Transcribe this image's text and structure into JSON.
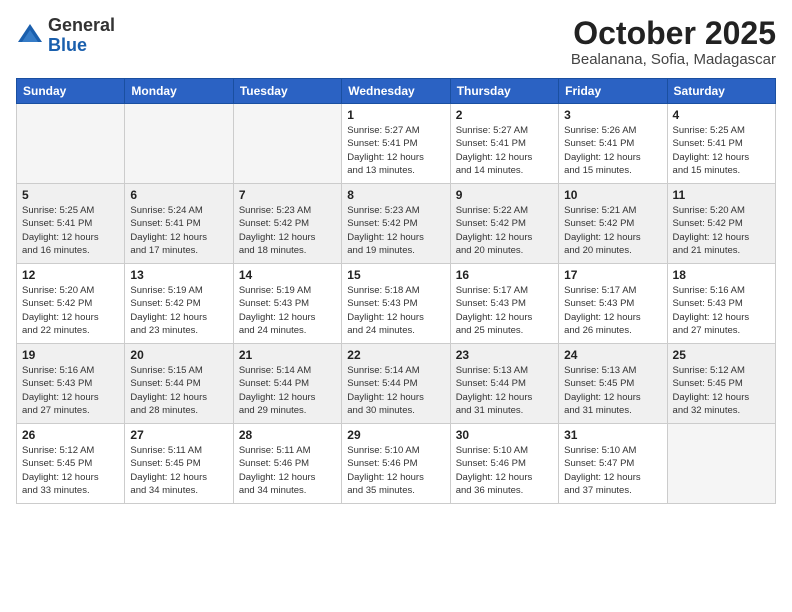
{
  "header": {
    "logo": {
      "general": "General",
      "blue": "Blue"
    },
    "title": "October 2025",
    "location": "Bealanana, Sofia, Madagascar"
  },
  "calendar": {
    "weekdays": [
      "Sunday",
      "Monday",
      "Tuesday",
      "Wednesday",
      "Thursday",
      "Friday",
      "Saturday"
    ],
    "weeks": [
      [
        {
          "day": "",
          "info": ""
        },
        {
          "day": "",
          "info": ""
        },
        {
          "day": "",
          "info": ""
        },
        {
          "day": "1",
          "info": "Sunrise: 5:27 AM\nSunset: 5:41 PM\nDaylight: 12 hours\nand 13 minutes."
        },
        {
          "day": "2",
          "info": "Sunrise: 5:27 AM\nSunset: 5:41 PM\nDaylight: 12 hours\nand 14 minutes."
        },
        {
          "day": "3",
          "info": "Sunrise: 5:26 AM\nSunset: 5:41 PM\nDaylight: 12 hours\nand 15 minutes."
        },
        {
          "day": "4",
          "info": "Sunrise: 5:25 AM\nSunset: 5:41 PM\nDaylight: 12 hours\nand 15 minutes."
        }
      ],
      [
        {
          "day": "5",
          "info": "Sunrise: 5:25 AM\nSunset: 5:41 PM\nDaylight: 12 hours\nand 16 minutes."
        },
        {
          "day": "6",
          "info": "Sunrise: 5:24 AM\nSunset: 5:41 PM\nDaylight: 12 hours\nand 17 minutes."
        },
        {
          "day": "7",
          "info": "Sunrise: 5:23 AM\nSunset: 5:42 PM\nDaylight: 12 hours\nand 18 minutes."
        },
        {
          "day": "8",
          "info": "Sunrise: 5:23 AM\nSunset: 5:42 PM\nDaylight: 12 hours\nand 19 minutes."
        },
        {
          "day": "9",
          "info": "Sunrise: 5:22 AM\nSunset: 5:42 PM\nDaylight: 12 hours\nand 20 minutes."
        },
        {
          "day": "10",
          "info": "Sunrise: 5:21 AM\nSunset: 5:42 PM\nDaylight: 12 hours\nand 20 minutes."
        },
        {
          "day": "11",
          "info": "Sunrise: 5:20 AM\nSunset: 5:42 PM\nDaylight: 12 hours\nand 21 minutes."
        }
      ],
      [
        {
          "day": "12",
          "info": "Sunrise: 5:20 AM\nSunset: 5:42 PM\nDaylight: 12 hours\nand 22 minutes."
        },
        {
          "day": "13",
          "info": "Sunrise: 5:19 AM\nSunset: 5:42 PM\nDaylight: 12 hours\nand 23 minutes."
        },
        {
          "day": "14",
          "info": "Sunrise: 5:19 AM\nSunset: 5:43 PM\nDaylight: 12 hours\nand 24 minutes."
        },
        {
          "day": "15",
          "info": "Sunrise: 5:18 AM\nSunset: 5:43 PM\nDaylight: 12 hours\nand 24 minutes."
        },
        {
          "day": "16",
          "info": "Sunrise: 5:17 AM\nSunset: 5:43 PM\nDaylight: 12 hours\nand 25 minutes."
        },
        {
          "day": "17",
          "info": "Sunrise: 5:17 AM\nSunset: 5:43 PM\nDaylight: 12 hours\nand 26 minutes."
        },
        {
          "day": "18",
          "info": "Sunrise: 5:16 AM\nSunset: 5:43 PM\nDaylight: 12 hours\nand 27 minutes."
        }
      ],
      [
        {
          "day": "19",
          "info": "Sunrise: 5:16 AM\nSunset: 5:43 PM\nDaylight: 12 hours\nand 27 minutes."
        },
        {
          "day": "20",
          "info": "Sunrise: 5:15 AM\nSunset: 5:44 PM\nDaylight: 12 hours\nand 28 minutes."
        },
        {
          "day": "21",
          "info": "Sunrise: 5:14 AM\nSunset: 5:44 PM\nDaylight: 12 hours\nand 29 minutes."
        },
        {
          "day": "22",
          "info": "Sunrise: 5:14 AM\nSunset: 5:44 PM\nDaylight: 12 hours\nand 30 minutes."
        },
        {
          "day": "23",
          "info": "Sunrise: 5:13 AM\nSunset: 5:44 PM\nDaylight: 12 hours\nand 31 minutes."
        },
        {
          "day": "24",
          "info": "Sunrise: 5:13 AM\nSunset: 5:45 PM\nDaylight: 12 hours\nand 31 minutes."
        },
        {
          "day": "25",
          "info": "Sunrise: 5:12 AM\nSunset: 5:45 PM\nDaylight: 12 hours\nand 32 minutes."
        }
      ],
      [
        {
          "day": "26",
          "info": "Sunrise: 5:12 AM\nSunset: 5:45 PM\nDaylight: 12 hours\nand 33 minutes."
        },
        {
          "day": "27",
          "info": "Sunrise: 5:11 AM\nSunset: 5:45 PM\nDaylight: 12 hours\nand 34 minutes."
        },
        {
          "day": "28",
          "info": "Sunrise: 5:11 AM\nSunset: 5:46 PM\nDaylight: 12 hours\nand 34 minutes."
        },
        {
          "day": "29",
          "info": "Sunrise: 5:10 AM\nSunset: 5:46 PM\nDaylight: 12 hours\nand 35 minutes."
        },
        {
          "day": "30",
          "info": "Sunrise: 5:10 AM\nSunset: 5:46 PM\nDaylight: 12 hours\nand 36 minutes."
        },
        {
          "day": "31",
          "info": "Sunrise: 5:10 AM\nSunset: 5:47 PM\nDaylight: 12 hours\nand 37 minutes."
        },
        {
          "day": "",
          "info": ""
        }
      ]
    ]
  }
}
